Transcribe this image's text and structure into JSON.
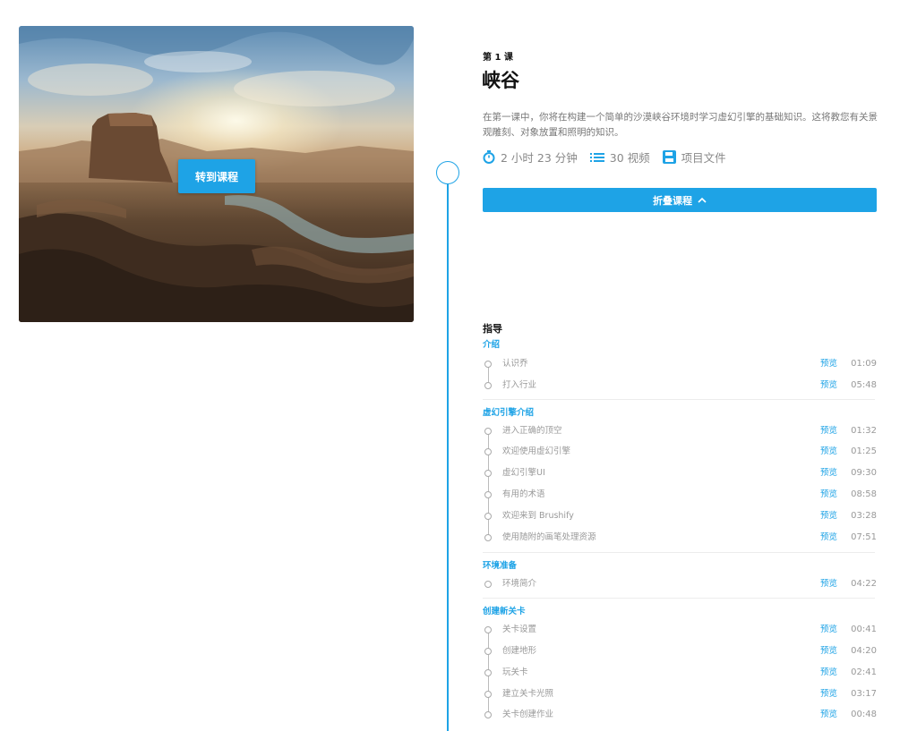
{
  "hero": {
    "button_label": "转到课程"
  },
  "lesson": {
    "number": "第 1 课",
    "title": "峡谷",
    "description": "在第一课中，你将在构建一个简单的沙漠峡谷环境时学习虚幻引擎的基础知识。这将教您有关景观雕刻、对象放置和照明的知识。",
    "duration": "2 小时 23 分钟",
    "videos": "30 视频",
    "project_files": "项目文件",
    "collapse_label": "折叠课程"
  },
  "curriculum": {
    "heading": "指导",
    "preview_label": "预览",
    "sections": [
      {
        "title": "介绍",
        "items": [
          {
            "name": "认识乔",
            "time": "01:09"
          },
          {
            "name": "打入行业",
            "time": "05:48"
          }
        ]
      },
      {
        "title": "虚幻引擎介绍",
        "items": [
          {
            "name": "进入正确的顶空",
            "time": "01:32"
          },
          {
            "name": "欢迎使用虚幻引擎",
            "time": "01:25"
          },
          {
            "name": "虚幻引擎UI",
            "time": "09:30"
          },
          {
            "name": "有用的术语",
            "time": "08:58"
          },
          {
            "name": "欢迎来到 Brushify",
            "time": "03:28"
          },
          {
            "name": "使用随附的画笔处理资源",
            "time": "07:51"
          }
        ]
      },
      {
        "title": "环境准备",
        "items": [
          {
            "name": "环境简介",
            "time": "04:22"
          }
        ]
      },
      {
        "title": "创建新关卡",
        "items": [
          {
            "name": "关卡设置",
            "time": "00:41"
          },
          {
            "name": "创建地形",
            "time": "04:20"
          },
          {
            "name": "玩关卡",
            "time": "02:41"
          },
          {
            "name": "建立关卡光照",
            "time": "03:17"
          },
          {
            "name": "关卡创建作业",
            "time": "00:48"
          }
        ]
      }
    ]
  }
}
